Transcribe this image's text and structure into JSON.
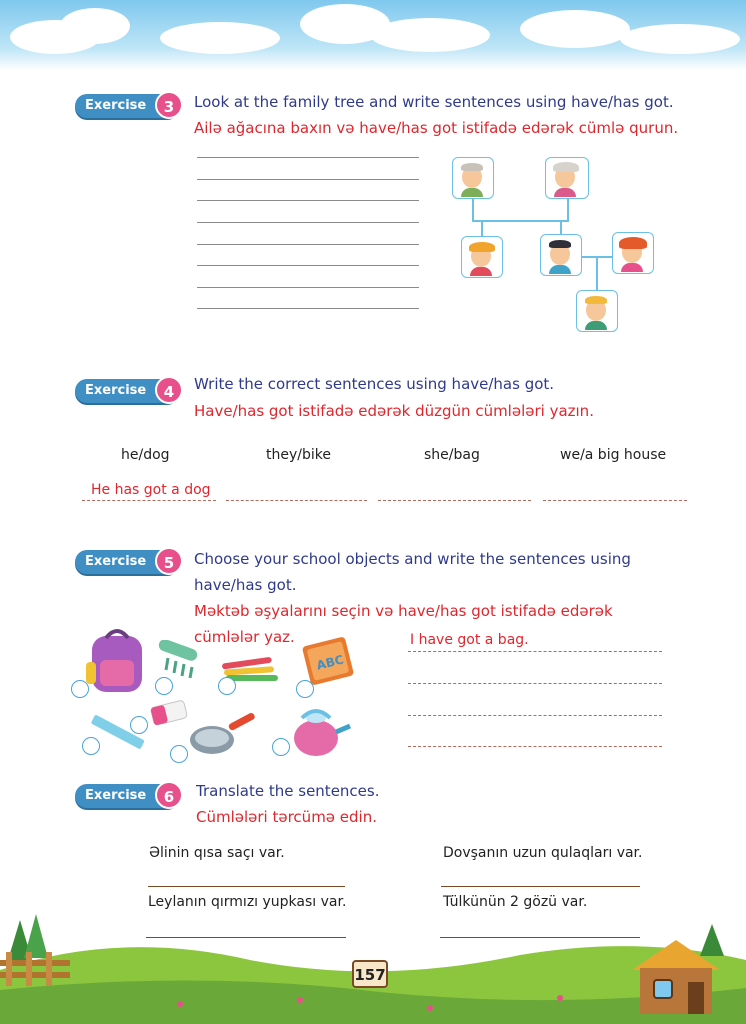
{
  "page_number": "157",
  "exercises": {
    "ex3": {
      "badge_label": "Exercise",
      "badge_number": "3",
      "instruction_en": "Look at the family tree and write sentences using have/has got.",
      "instruction_az": "Ailə ağacına baxın və have/has got istifadə edərək cümlə qurun."
    },
    "ex4": {
      "badge_label": "Exercise",
      "badge_number": "4",
      "instruction_en": "Write the correct sentences using have/has got.",
      "instruction_az": "Have/has got istifadə edərək düzgün cümlələri yazın.",
      "prompts": [
        "he/dog",
        "they/bike",
        "she/bag",
        "we/a big house"
      ],
      "example_answer": "He has got a dog"
    },
    "ex5": {
      "badge_label": "Exercise",
      "badge_number": "5",
      "instruction_en_line1": "Choose your school objects and write the sentences using",
      "instruction_en_line2": "have/has got.",
      "instruction_az_line1": "Məktəb əşyalarını seçin və have/has got istifadə edərək",
      "instruction_az_line2": "cümlələr yaz.",
      "example_answer": "I have got a bag.",
      "objects": [
        "backpack",
        "comb",
        "crayons",
        "abc-book",
        "ruler",
        "eraser",
        "frying-pan",
        "kettle"
      ],
      "book_cover_text": "ABC"
    },
    "ex6": {
      "badge_label": "Exercise",
      "badge_number": "6",
      "instruction_en": "Translate the sentences.",
      "instruction_az": "Cümlələri tərcümə edin.",
      "sentences": [
        "Əlinin qısa saçı var.",
        "Dovşanın uzun qulaqları var.",
        "Leylanın qırmızı yupkası var.",
        "Tülkünün 2 gözü var."
      ]
    }
  },
  "colors": {
    "instruction_blue": "#2f3a8c",
    "instruction_red": "#e0262d",
    "badge_blue": "#3f8fc5",
    "badge_pink": "#e7508a"
  }
}
